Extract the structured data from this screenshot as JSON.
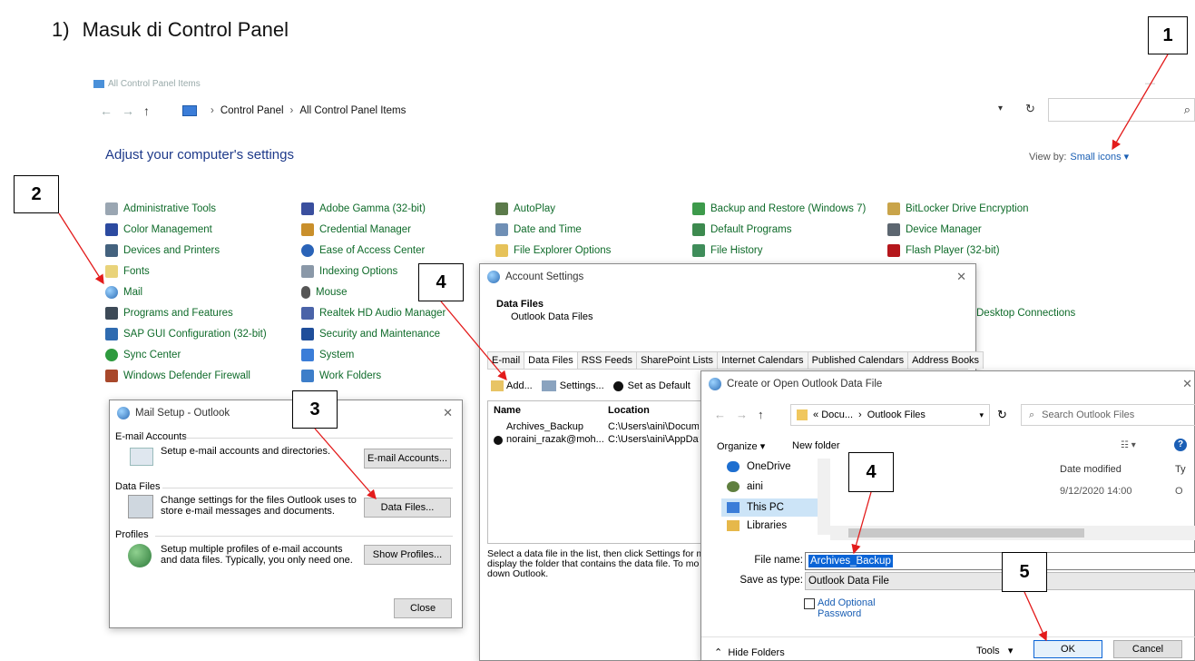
{
  "heading": {
    "number": "1)",
    "text": "Masuk di Control Panel"
  },
  "callouts": [
    "1",
    "2",
    "3",
    "4",
    "4",
    "5"
  ],
  "control_panel": {
    "window_title": "All Control Panel Items",
    "breadcrumb": [
      "Control Panel",
      "All Control Panel Items"
    ],
    "search_placeholder": "",
    "adjust_title": "Adjust your computer's settings",
    "view_by_label": "View by:",
    "view_by_value": "Small icons",
    "items": [
      "Administrative Tools",
      "Adobe Gamma (32-bit)",
      "AutoPlay",
      "Backup and Restore (Windows 7)",
      "BitLocker Drive Encryption",
      "Color Management",
      "Credential Manager",
      "Date and Time",
      "Default Programs",
      "Device Manager",
      "Devices and Printers",
      "Ease of Access Center",
      "File Explorer Options",
      "File History",
      "Flash Player (32-bit)",
      "Fonts",
      "Indexing Options",
      "Mail",
      "Mouse",
      "Programs and Features",
      "Realtek HD Audio Manager",
      "SAP GUI Configuration (32-bit)",
      "Security and Maintenance",
      "Sync Center",
      "System",
      "Windows Defender Firewall",
      "Work Folders",
      "Desktop Connections"
    ]
  },
  "mail_setup": {
    "title": "Mail Setup - Outlook",
    "email_group": "E-mail Accounts",
    "email_desc": "Setup e-mail accounts and directories.",
    "email_button": "E-mail Accounts...",
    "data_group": "Data Files",
    "data_desc": "Change settings for the files Outlook uses to store e-mail messages and documents.",
    "data_button": "Data Files...",
    "profiles_group": "Profiles",
    "profiles_desc": "Setup multiple profiles of e-mail accounts and data files. Typically, you only need one.",
    "profiles_button": "Show Profiles...",
    "close_button": "Close"
  },
  "account_settings": {
    "title": "Account Settings",
    "section_title": "Data Files",
    "section_sub": "Outlook Data Files",
    "tabs": [
      "E-mail",
      "Data Files",
      "RSS Feeds",
      "SharePoint Lists",
      "Internet Calendars",
      "Published Calendars",
      "Address Books"
    ],
    "toolbar": {
      "add": "Add...",
      "settings": "Settings...",
      "set_default": "Set as Default"
    },
    "columns": [
      "Name",
      "Location"
    ],
    "rows": [
      {
        "name": "Archives_Backup",
        "location": "C:\\Users\\aini\\Documents"
      },
      {
        "name": "noraini_razak@moh....",
        "location": "C:\\Users\\aini\\AppData"
      }
    ],
    "help_text": "Select a data file in the list, then click Settings for m display the folder that contains the data file. To mo down Outlook."
  },
  "create_dialog": {
    "title": "Create or Open Outlook Data File",
    "path": [
      "Docu...",
      "Outlook Files"
    ],
    "path_prefix": "«",
    "search_placeholder": "Search Outlook Files",
    "organize": "Organize",
    "new_folder": "New folder",
    "tree": [
      "OneDrive",
      "aini",
      "This PC",
      "Libraries"
    ],
    "date_modified_header": "Date modified",
    "type_header": "Ty",
    "date_value": "9/12/2020 14:00",
    "type_value": "O",
    "file_name_label": "File name:",
    "file_name_value": "Archives_Backup",
    "save_as_label": "Save as type:",
    "save_as_value": "Outlook Data File",
    "add_password": "Add Optional Password",
    "hide_folders": "Hide Folders",
    "tools": "Tools",
    "ok": "OK",
    "cancel": "Cancel"
  },
  "colors": {
    "arrow": "#e31b1b",
    "cp_link": "#0f6b2a",
    "accent": "#0a64d6"
  }
}
